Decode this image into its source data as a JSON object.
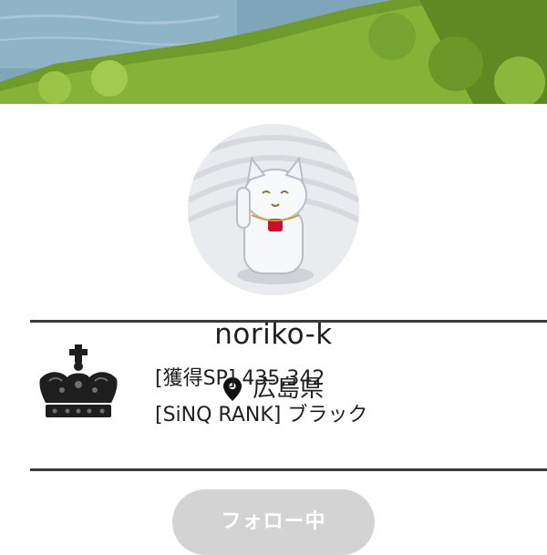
{
  "profile": {
    "username": "noriko-k",
    "location": "広島県"
  },
  "stats": {
    "sp_label": "[獲得SP]",
    "sp_value": "435,342",
    "rank_label": "[SiNQ RANK]",
    "rank_value": "ブラック"
  },
  "actions": {
    "follow_label": "フォロー中"
  },
  "icons": {
    "location": "map-pin-icon",
    "rank": "crown-icon"
  },
  "colors": {
    "divider": "#3a3a3a",
    "follow_button_bg": "#d3d3d3",
    "follow_button_text": "#ffffff"
  }
}
